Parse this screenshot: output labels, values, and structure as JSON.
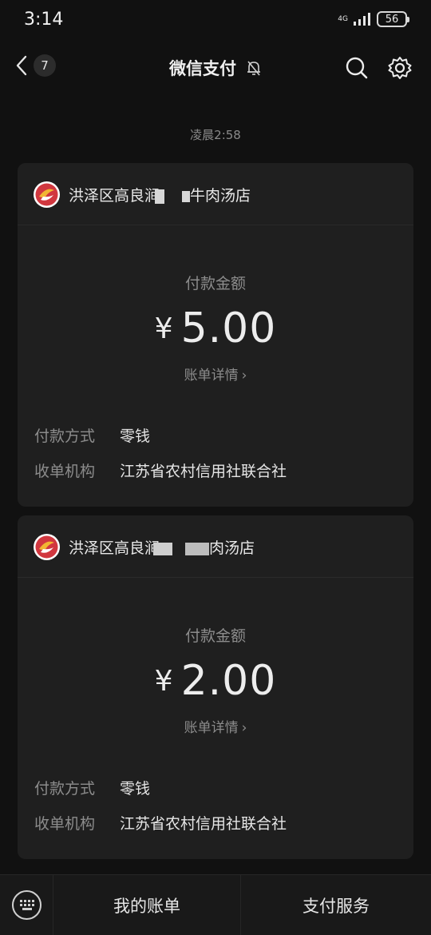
{
  "status": {
    "time": "3:14",
    "network": "4G",
    "battery": "56"
  },
  "nav": {
    "back_count": "7",
    "title": "微信支付"
  },
  "timestamp": "凌晨2:58",
  "cards": [
    {
      "merchant_start": "洪泽区高良涧",
      "merchant_end": "牛肉汤店",
      "amount_label": "付款金额",
      "currency": "¥",
      "amount": "5.00",
      "detail_link": "账单详情",
      "rows": [
        {
          "key": "付款方式",
          "value": "零钱"
        },
        {
          "key": "收单机构",
          "value": "江苏省农村信用社联合社"
        }
      ]
    },
    {
      "merchant_start": "洪泽区高良涧",
      "merchant_end": "肉汤店",
      "amount_label": "付款金额",
      "currency": "¥",
      "amount": "2.00",
      "detail_link": "账单详情",
      "rows": [
        {
          "key": "付款方式",
          "value": "零钱"
        },
        {
          "key": "收单机构",
          "value": "江苏省农村信用社联合社"
        }
      ]
    }
  ],
  "bottom_menu": {
    "item1": "我的账单",
    "item2": "支付服务"
  }
}
